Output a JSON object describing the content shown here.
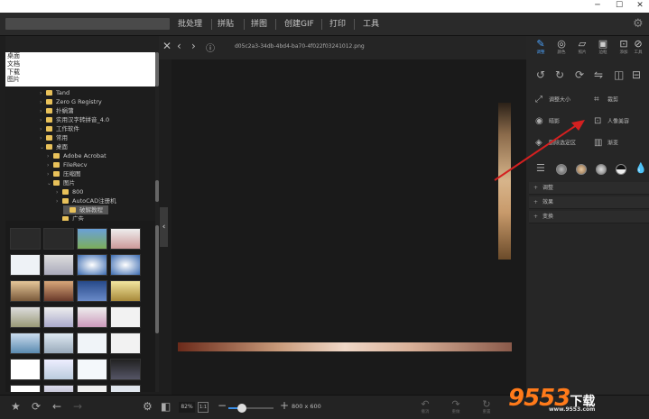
{
  "window": {
    "minimize": "─",
    "maximize": "☐",
    "close": "✕"
  },
  "menu": {
    "items": [
      "批处理",
      "拼贴",
      "拼图",
      "创建GIF",
      "打印",
      "工具"
    ]
  },
  "left": {
    "quick": [
      "桌面",
      "文档",
      "下载",
      "图片"
    ],
    "tree": [
      {
        "label": "Tand",
        "indent": 38,
        "arrow": "›"
      },
      {
        "label": "Zero G Registry",
        "indent": 38,
        "arrow": "›"
      },
      {
        "label": "扑蜗蒲",
        "indent": 38,
        "arrow": "›"
      },
      {
        "label": "实用汉字转拼音_4.0",
        "indent": 38,
        "arrow": "›"
      },
      {
        "label": "工作软件",
        "indent": 38,
        "arrow": "›"
      },
      {
        "label": "常用",
        "indent": 38,
        "arrow": "›"
      },
      {
        "label": "桌面",
        "indent": 38,
        "arrow": "⌄"
      },
      {
        "label": "Adobe Acrobat",
        "indent": 46,
        "arrow": "›"
      },
      {
        "label": "FileRecv",
        "indent": 46,
        "arrow": "›"
      },
      {
        "label": "压缩图",
        "indent": 46,
        "arrow": "›"
      },
      {
        "label": "图片",
        "indent": 46,
        "arrow": "⌄"
      },
      {
        "label": "800",
        "indent": 56,
        "arrow": "›"
      },
      {
        "label": "AutoCAD注册机",
        "indent": 56,
        "arrow": "›"
      },
      {
        "label": "破解教程",
        "indent": 64,
        "arrow": ""
      },
      {
        "label": "广告",
        "indent": 56,
        "arrow": ""
      }
    ]
  },
  "canvas": {
    "filename": "d05c2a3-34db-4bd4-ba70-4f022f03241012.png"
  },
  "right": {
    "tools": [
      "调整",
      "颜色",
      "照片",
      "边框",
      "添加",
      "工具"
    ],
    "options": {
      "resize": "调整大小",
      "crop": "裁剪",
      "vignette": "暗影",
      "portrait": "人像美容",
      "vignette_color": "删除选定区",
      "gradient": "渐变"
    },
    "sections": [
      "调整",
      "效果",
      "变换"
    ]
  },
  "bottom": {
    "zoom": "82%",
    "fit": "1:1",
    "zoom_level": 0.3,
    "image_size": "800 x 600",
    "actions": [
      "撤消",
      "重做",
      "重置"
    ]
  },
  "watermark": {
    "number": "9553",
    "suffix": "下载",
    "site": "www.9553.com"
  },
  "colors": {
    "accent": "#3b8fe8",
    "folder": "#e8c15a",
    "arrow": "#d42020"
  }
}
